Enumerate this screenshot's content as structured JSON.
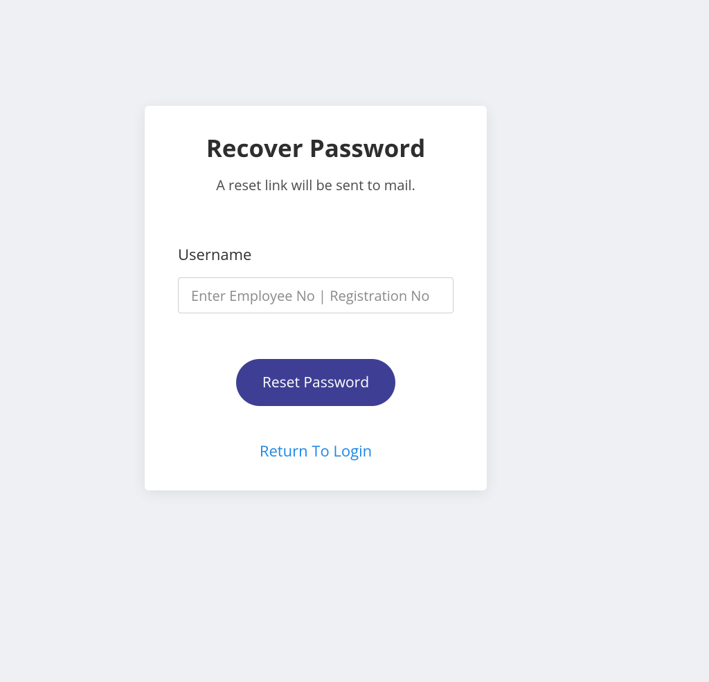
{
  "card": {
    "title": "Recover Password",
    "subtitle": "A reset link will be sent to mail.",
    "username": {
      "label": "Username",
      "placeholder": "Enter Employee No | Registration No",
      "value": ""
    },
    "reset_button_label": "Reset Password",
    "return_link_label": "Return To Login"
  }
}
